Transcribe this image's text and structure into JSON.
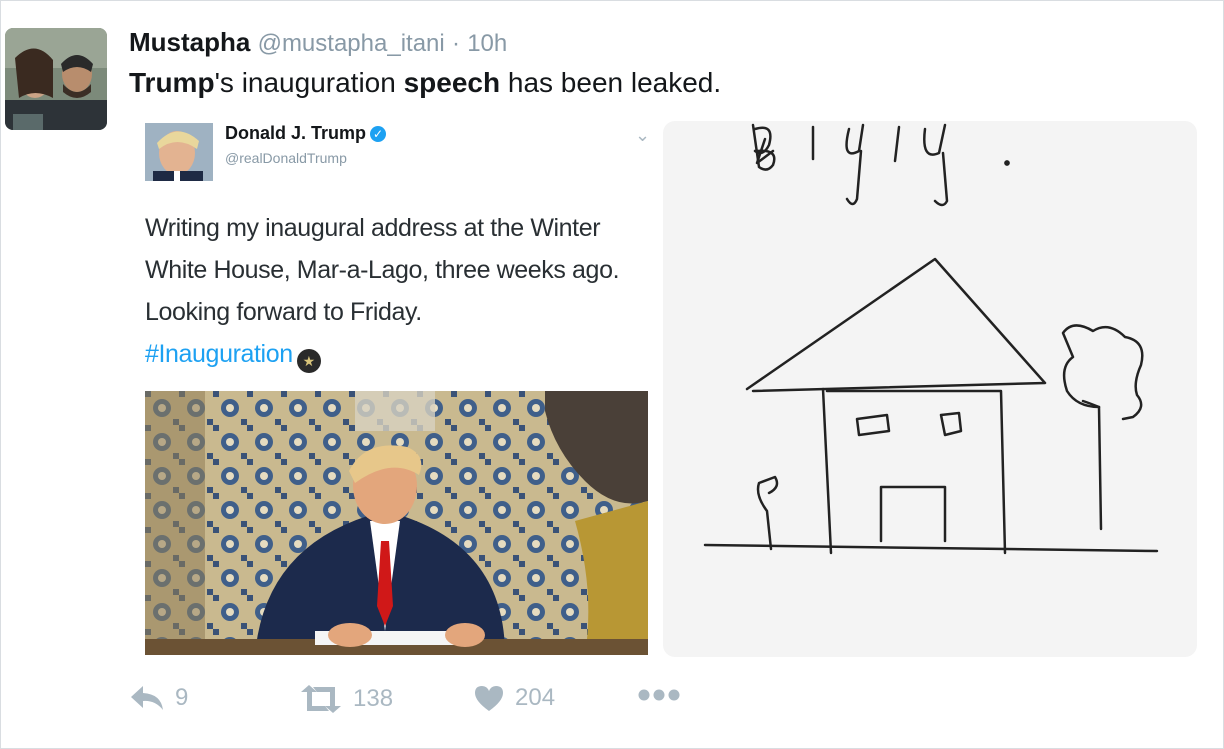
{
  "tweet": {
    "author_name": "Mustapha",
    "author_handle": "@mustapha_itani",
    "separator": "·",
    "time": "10h",
    "text_part1": "Trump",
    "text_part2": "'s inauguration ",
    "text_part3": "speech",
    "text_part4": " has been leaked."
  },
  "quoted_tweet": {
    "author_name": "Donald J. Trump",
    "author_handle": "@realDonaldTrump",
    "text": "Writing my inaugural address at the Winter White House, Mar-a-Lago, three weeks ago. Looking forward to Friday.",
    "hashtag": "#Inauguration",
    "verified": true
  },
  "drawing": {
    "scribble_text": "Bigly."
  },
  "actions": {
    "reply_count": "9",
    "retweet_count": "138",
    "like_count": "204"
  },
  "icons": {
    "reply": "reply-icon",
    "retweet": "retweet-icon",
    "like": "heart-icon",
    "more": "more-icon",
    "chevron": "chevron-down-icon",
    "verified": "verified-badge-icon"
  },
  "colors": {
    "link": "#1da1f2",
    "muted": "#8899a6",
    "icon": "#aab8c2"
  }
}
